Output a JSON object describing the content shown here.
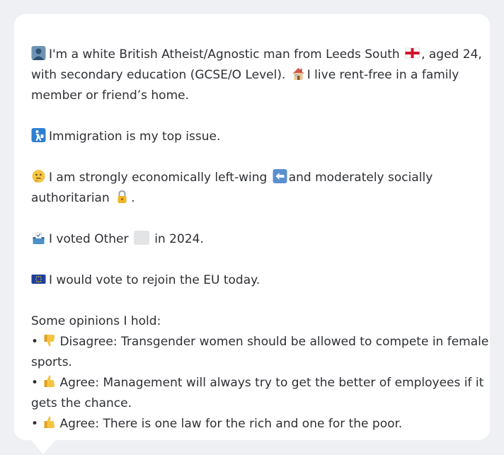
{
  "profile": {
    "line1": "I'm a white British Atheist/Agnostic man from Leeds South",
    "line1b": ", aged 24,",
    "line2a": "with secondary education (GCSE/O Level).",
    "line2b": "I live rent-free in a family",
    "line3": "member or friend’s home.",
    "top_issue": "Immigration is my top issue.",
    "politics_a": "I am strongly economically left-wing",
    "politics_b": "and moderately socially",
    "politics_c": "authoritarian",
    "politics_c_end": ".",
    "vote_a": "I voted Other",
    "vote_b": "in 2024.",
    "eu": "I would vote to rejoin the EU today."
  },
  "opinions": {
    "heading": "Some opinions I hold:",
    "bullet": "•",
    "items": [
      {
        "stance": "Disagree",
        "line1": "Disagree: Transgender women should be allowed to compete in female",
        "line2": "sports."
      },
      {
        "stance": "Agree",
        "line1": "Agree: Management will always try to get the better of employees if it",
        "line2": "gets the chance."
      },
      {
        "stance": "Agree",
        "line1": "Agree: There is one law for the rich and one for the poor."
      }
    ]
  },
  "colors": {
    "card_bg": "#ffffff",
    "page_bg": "#eef0f3",
    "text": "#2d2f33",
    "other_party_swatch": "#e3e4e6"
  },
  "icons": [
    "person-icon",
    "england-flag-icon",
    "house-icon",
    "immigration-icon",
    "thinking-face-icon",
    "left-arrow-icon",
    "lock-icon",
    "ballot-box-icon",
    "eu-flag-icon",
    "thumbs-down-icon",
    "thumbs-up-icon"
  ]
}
